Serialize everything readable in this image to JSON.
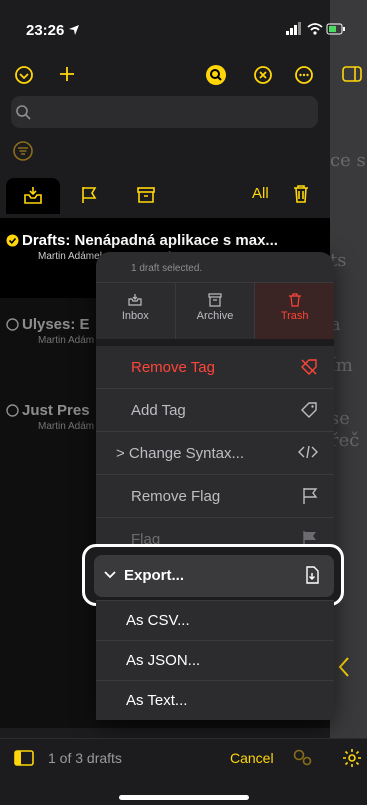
{
  "status": {
    "time": "23:26"
  },
  "editor_ghost": {
    "line1": "ce s",
    "line2": "ts",
    "line3": "a",
    "line4": "ím",
    "line5": "se",
    "line6": "řeč"
  },
  "tabs": {
    "all_label": "All"
  },
  "rows": [
    {
      "title": "Drafts: Nenápadná aplikace s max...",
      "author": "Martin Adámek, recenze, Drafts"
    },
    {
      "title": "Ulyses: E",
      "author": "Martin Adám"
    },
    {
      "title": "Just Pres",
      "author": "Martin Adám"
    }
  ],
  "menu": {
    "header": "1 draft selected.",
    "actions": [
      {
        "label": "Inbox",
        "icon": "inbox-icon"
      },
      {
        "label": "Archive",
        "icon": "archive-icon"
      },
      {
        "label": "Trash",
        "icon": "trash-icon"
      }
    ],
    "items": [
      {
        "label": "Remove Tag",
        "icon": "tag-remove-icon"
      },
      {
        "label": "Add Tag",
        "icon": "tag-icon"
      },
      {
        "label": "> Change Syntax...",
        "icon": "code-icon"
      },
      {
        "label": "Remove Flag",
        "icon": "flag-outline-icon"
      },
      {
        "label": "Flag",
        "icon": "flag-filled-icon"
      }
    ],
    "export": {
      "label": "Export...",
      "sub": [
        "As CSV...",
        "As JSON...",
        "As Text..."
      ]
    }
  },
  "bottom": {
    "count": "1 of 3 drafts",
    "cancel": "Cancel"
  },
  "colors": {
    "accent": "#ffd60a",
    "danger": "#ff453a"
  }
}
